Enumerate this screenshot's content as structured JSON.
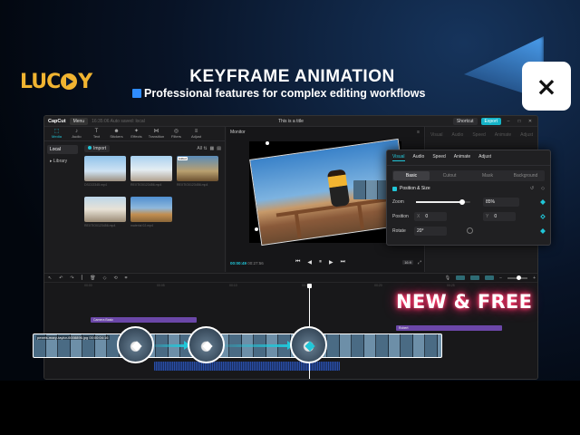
{
  "promo": {
    "logo_text": "LUCKY",
    "headline": "KEYFRAME ANIMATION",
    "subheadline": "Professional features for complex editing workflows",
    "badge": "NEW & FREE",
    "app_icon_name": "capcut-logo-icon"
  },
  "titlebar": {
    "brand": "CapCut",
    "menu": "Menu",
    "autosave": "16:35:06 Auto saved: local",
    "project_title": "This is a title",
    "shortcut": "Shortcut",
    "export": "Export",
    "window_controls": [
      "–",
      "□",
      "✕"
    ]
  },
  "media_tabs": [
    {
      "icon": "⬚",
      "label": "Media"
    },
    {
      "icon": "♪",
      "label": "Audio"
    },
    {
      "icon": "T",
      "label": "Text"
    },
    {
      "icon": "☻",
      "label": "Stickers"
    },
    {
      "icon": "✦",
      "label": "Effects"
    },
    {
      "icon": "⋈",
      "label": "Transition"
    },
    {
      "icon": "◎",
      "label": "Filters"
    },
    {
      "icon": "≡",
      "label": "Adjust"
    }
  ],
  "media_side": {
    "local": "Local",
    "library": "▸ Library"
  },
  "media_tools": {
    "import": "Import",
    "all": "All ⇅"
  },
  "media_items": [
    {
      "caption": "DSC02345.mp4",
      "tag": ""
    },
    {
      "caption": "REXTIO0123456.mp4",
      "tag": ""
    },
    {
      "caption": "REXTIO0123456.mp4",
      "tag": "Added"
    },
    {
      "caption": "REXTIO0123456.mp4",
      "tag": ""
    },
    {
      "caption": "material 02.mp4",
      "tag": ""
    }
  ],
  "monitor": {
    "label": "Monitor",
    "current_time": "00:00:49",
    "total_time": "00:27:56",
    "ratio": "16:9",
    "controls": [
      "⏮",
      "◀",
      "⏸",
      "▶",
      "⏭"
    ]
  },
  "right_panel": {
    "ghost_tabs": [
      "Visual",
      "Audio",
      "Speed",
      "Animate",
      "Adjust"
    ]
  },
  "inspector": {
    "tabs": [
      "Visual",
      "Audio",
      "Speed",
      "Animate",
      "Adjust"
    ],
    "subtabs": [
      "Basic",
      "Cutout",
      "Mask",
      "Background"
    ],
    "section": "Position & Size",
    "zoom_label": "Zoom",
    "zoom_value": "85%",
    "zoom_fraction": 0.85,
    "position_label": "Position",
    "pos_x_key": "X",
    "pos_x": "0",
    "pos_y_key": "Y",
    "pos_y": "0",
    "rotate_label": "Rotate",
    "rotate_value": "20°"
  },
  "timeline": {
    "ruler": [
      "00:00",
      "00:05",
      "00:10",
      "00:15",
      "00:20",
      "00:25"
    ],
    "text_track_1": "Camera Basic",
    "text_track_2": "Robert",
    "main_clip_label": "pexels-mary-taylor-6008896.jpg  00:00:04:16"
  },
  "colors": {
    "accent": "#21c6d8",
    "logo": "#f1b431",
    "text_track": "#6b47a8",
    "glow": "#ff3a6a"
  }
}
